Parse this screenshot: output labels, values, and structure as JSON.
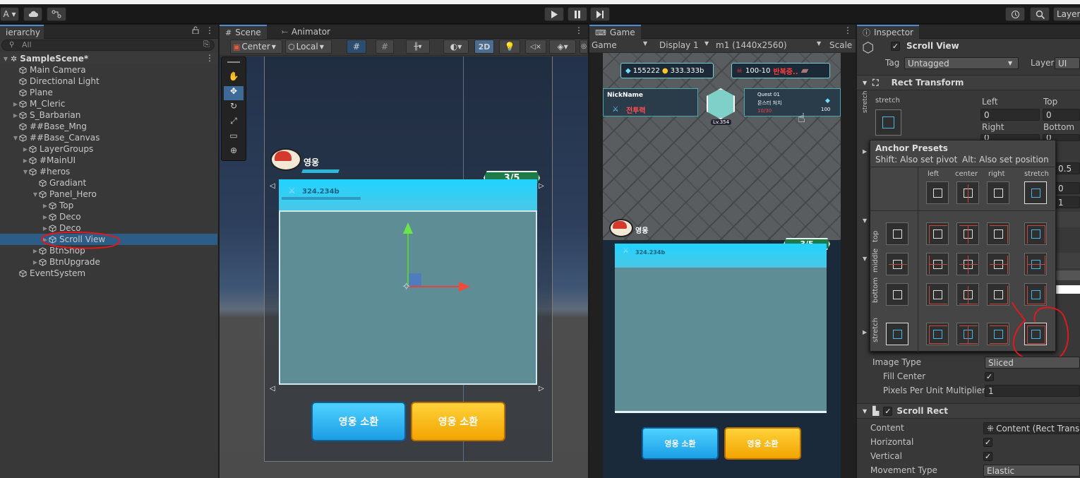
{
  "toolbar": {
    "account": "A ▾",
    "layers": "Layer"
  },
  "hierarchy": {
    "tab": "ierarchy",
    "search_placeholder": "All",
    "scene": "SampleScene*",
    "items": [
      {
        "label": "Main Camera"
      },
      {
        "label": "Directional Light"
      },
      {
        "label": "Plane"
      },
      {
        "label": "M_Cleric"
      },
      {
        "label": "S_Barbarian"
      },
      {
        "label": "##Base_Mng"
      },
      {
        "label": "##Base_Canvas"
      },
      {
        "label": "LayerGroups"
      },
      {
        "label": "#MainUI"
      },
      {
        "label": "#heros"
      },
      {
        "label": "Gradiant"
      },
      {
        "label": "Panel_Hero"
      },
      {
        "label": "Top"
      },
      {
        "label": "Deco"
      },
      {
        "label": "Deco"
      },
      {
        "label": "Scroll View"
      },
      {
        "label": "BtnShop"
      },
      {
        "label": "BtnUpgrade"
      },
      {
        "label": "EventSystem"
      }
    ]
  },
  "scene": {
    "tab_scene": "Scene",
    "tab_animator": "Animator",
    "pivot": "Center",
    "space": "Local",
    "mode2d": "2D"
  },
  "game_ui": {
    "hero_label": "영웅",
    "combat_value": "324.234b",
    "count": "3/5",
    "summon1": "영웅 소환",
    "summon2": "영웅 소환",
    "gems": "155222",
    "gold": "333.333b",
    "stage": "100-10",
    "stage_tag": "반복중..",
    "nickname": "NickName",
    "power": "전투력",
    "level": "Lv.354",
    "quest_title": "Quest 01",
    "quest_desc": "몬스터 처치",
    "quest_prog": "10/30",
    "gem_small": "100"
  },
  "game": {
    "tab": "Game",
    "view": "Game",
    "display": "Display 1",
    "resolution": "m1 (1440x2560)",
    "scale": "Scale"
  },
  "inspector": {
    "tab": "Inspector",
    "object_name": "Scroll View",
    "tag_label": "Tag",
    "tag_value": "Untagged",
    "layer_label": "Layer",
    "layer_value": "UI",
    "rect_transform": "Rect Transform",
    "stretch": "stretch",
    "left_label": "Left",
    "left_value": "0",
    "top_label": "Top",
    "top_value": "0",
    "right_label": "Right",
    "bottom_label": "Bottom",
    "right_value": "0",
    "bottom_value": "0",
    "partial_values": [
      "0.5",
      "0",
      "1"
    ],
    "image_type_label": "Image Type",
    "image_type_value": "Sliced",
    "fill_center": "Fill Center",
    "ppu_label": "Pixels Per Unit Multiplier",
    "ppu_value": "1",
    "scroll_rect": "Scroll Rect",
    "content_label": "Content",
    "content_value": "Content (Rect Transfo",
    "horizontal": "Horizontal",
    "vertical": "Vertical",
    "movement_label": "Movement Type",
    "movement_value": "Elastic"
  },
  "anchor_presets": {
    "title": "Anchor Presets",
    "hint_shift": "Shift: Also set pivot",
    "hint_alt": "Alt: Also set position",
    "cols": [
      "left",
      "center",
      "right",
      "stretch"
    ],
    "rows": [
      "top",
      "middle",
      "bottom",
      "stretch"
    ]
  },
  "colors": {
    "accent": "#4e8ad0",
    "selection": "#2c5d87",
    "annotation": "#e0191e"
  }
}
